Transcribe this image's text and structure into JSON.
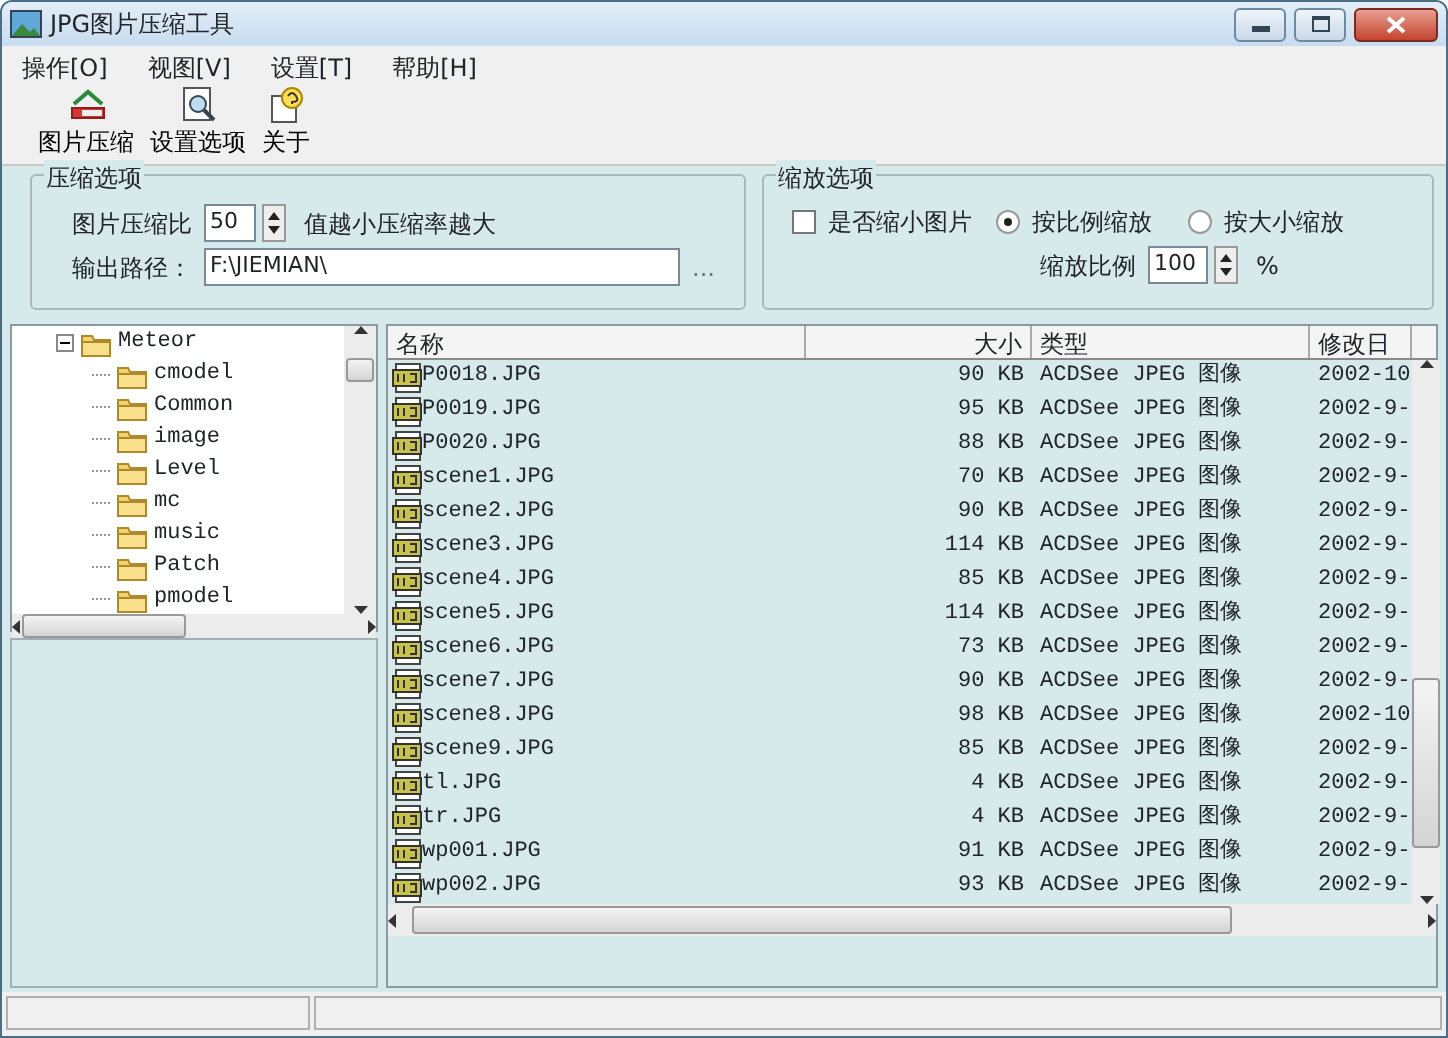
{
  "window": {
    "title": "JPG图片压缩工具"
  },
  "menu": [
    {
      "label": "操作[O]"
    },
    {
      "label": "视图[V]"
    },
    {
      "label": "设置[T]"
    },
    {
      "label": "帮助[H]"
    }
  ],
  "toolbar": [
    {
      "label": "图片压缩",
      "kind": "compress"
    },
    {
      "label": "设置选项",
      "kind": "settings"
    },
    {
      "label": "关于",
      "kind": "about"
    }
  ],
  "compression": {
    "title": "压缩选项",
    "ratio_label": "图片压缩比",
    "ratio_value": "50",
    "hint": "值越小压缩率越大",
    "path_label": "输出路径：",
    "path_value": "F:\\JIEMIAN\\",
    "browse": "..."
  },
  "scale": {
    "title": "缩放选项",
    "shrink": {
      "label": "是否缩小图片",
      "checked": false
    },
    "modes": [
      {
        "label": "按比例缩放",
        "selected": true
      },
      {
        "label": "按大小缩放",
        "selected": false
      }
    ],
    "ratio_label": "缩放比例",
    "ratio_value": "100",
    "unit": "%"
  },
  "tree": {
    "items": [
      {
        "label": "Meteor",
        "expanded": true,
        "children": [
          {
            "label": "cmodel"
          },
          {
            "label": "Common"
          },
          {
            "label": "image"
          },
          {
            "label": "Level"
          },
          {
            "label": "mc"
          },
          {
            "label": "music"
          },
          {
            "label": "Patch"
          },
          {
            "label": "pmodel"
          }
        ]
      }
    ]
  },
  "files": {
    "columns": [
      "名称",
      "大小",
      "类型",
      "修改日"
    ],
    "rows": [
      [
        "P0018.JPG",
        "90 KB",
        "ACDSee JPEG 图像",
        "2002-10"
      ],
      [
        "P0019.JPG",
        "95 KB",
        "ACDSee JPEG 图像",
        "2002-9-"
      ],
      [
        "P0020.JPG",
        "88 KB",
        "ACDSee JPEG 图像",
        "2002-9-"
      ],
      [
        "scene1.JPG",
        "70 KB",
        "ACDSee JPEG 图像",
        "2002-9-"
      ],
      [
        "scene2.JPG",
        "90 KB",
        "ACDSee JPEG 图像",
        "2002-9-"
      ],
      [
        "scene3.JPG",
        "114 KB",
        "ACDSee JPEG 图像",
        "2002-9-"
      ],
      [
        "scene4.JPG",
        "85 KB",
        "ACDSee JPEG 图像",
        "2002-9-"
      ],
      [
        "scene5.JPG",
        "114 KB",
        "ACDSee JPEG 图像",
        "2002-9-"
      ],
      [
        "scene6.JPG",
        "73 KB",
        "ACDSee JPEG 图像",
        "2002-9-"
      ],
      [
        "scene7.JPG",
        "90 KB",
        "ACDSee JPEG 图像",
        "2002-9-"
      ],
      [
        "scene8.JPG",
        "98 KB",
        "ACDSee JPEG 图像",
        "2002-10"
      ],
      [
        "scene9.JPG",
        "85 KB",
        "ACDSee JPEG 图像",
        "2002-9-"
      ],
      [
        "tl.JPG",
        "4 KB",
        "ACDSee JPEG 图像",
        "2002-9-"
      ],
      [
        "tr.JPG",
        "4 KB",
        "ACDSee JPEG 图像",
        "2002-9-"
      ],
      [
        "wp001.JPG",
        "91 KB",
        "ACDSee JPEG 图像",
        "2002-9-"
      ],
      [
        "wp002.JPG",
        "93 KB",
        "ACDSee JPEG 图像",
        "2002-9-"
      ]
    ]
  }
}
